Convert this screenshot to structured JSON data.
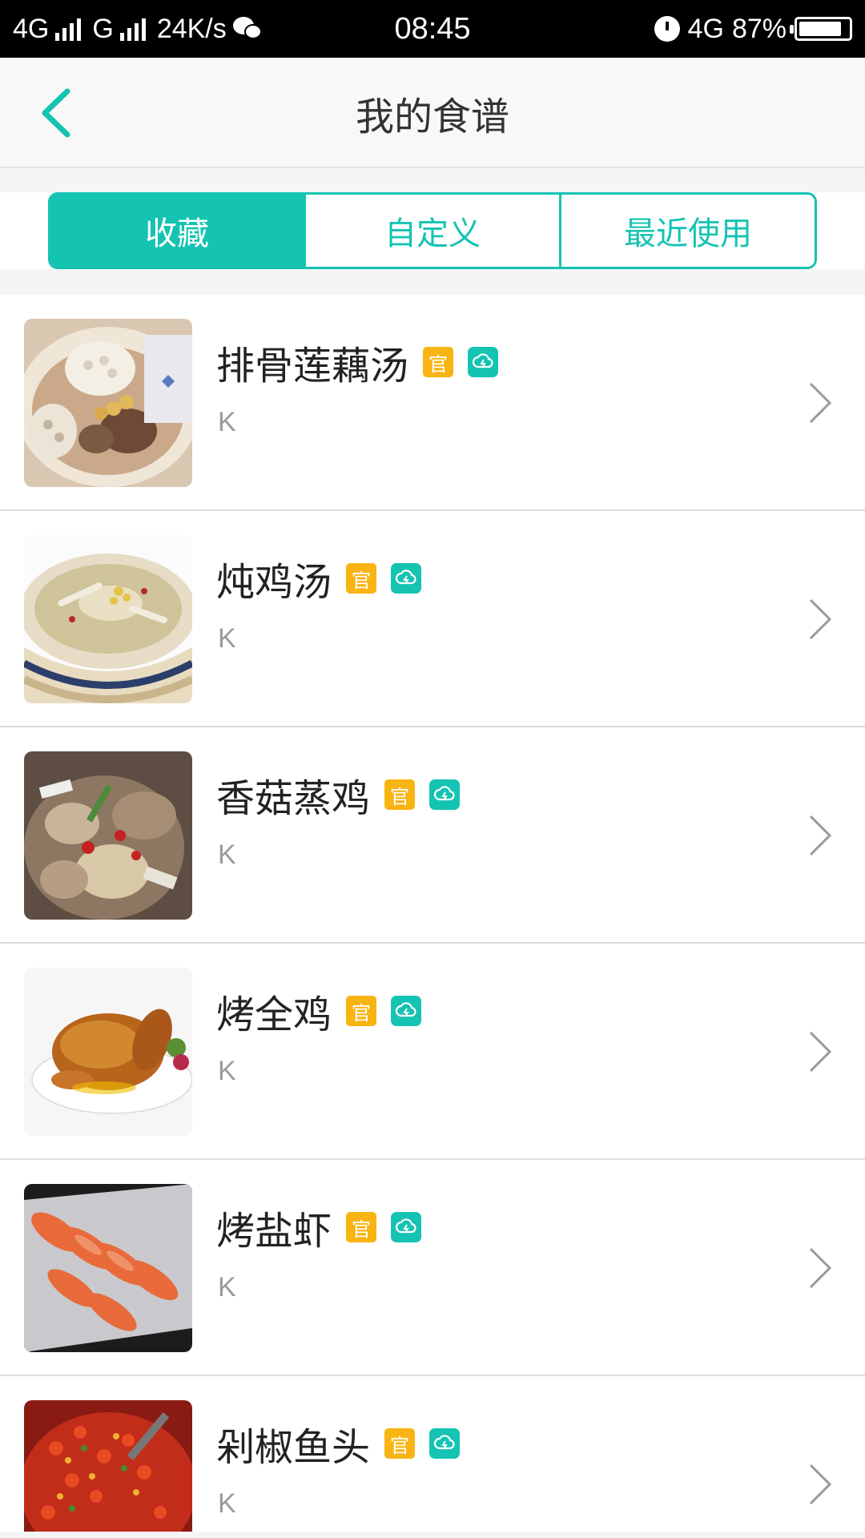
{
  "status_bar": {
    "network1": "4G",
    "network2": "G",
    "speed": "24K/s",
    "time": "08:45",
    "network3": "4G",
    "battery": "87%"
  },
  "header": {
    "title": "我的食谱"
  },
  "tabs": [
    {
      "label": "收藏",
      "active": true
    },
    {
      "label": "自定义",
      "active": false
    },
    {
      "label": "最近使用",
      "active": false
    }
  ],
  "recipes": [
    {
      "name": "排骨莲藕汤",
      "subtitle": "K",
      "badge": "官",
      "image": "lotus-root-soup"
    },
    {
      "name": "炖鸡汤",
      "subtitle": "K",
      "badge": "官",
      "image": "chicken-soup"
    },
    {
      "name": "香菇蒸鸡",
      "subtitle": "K",
      "badge": "官",
      "image": "steamed-chicken"
    },
    {
      "name": "烤全鸡",
      "subtitle": "K",
      "badge": "官",
      "image": "roast-chicken"
    },
    {
      "name": "烤盐虾",
      "subtitle": "K",
      "badge": "官",
      "image": "salt-baked-shrimp"
    },
    {
      "name": "剁椒鱼头",
      "subtitle": "K",
      "badge": "官",
      "image": "chili-fish-head"
    }
  ],
  "colors": {
    "accent": "#15c3b2",
    "badge": "#f8b413"
  }
}
